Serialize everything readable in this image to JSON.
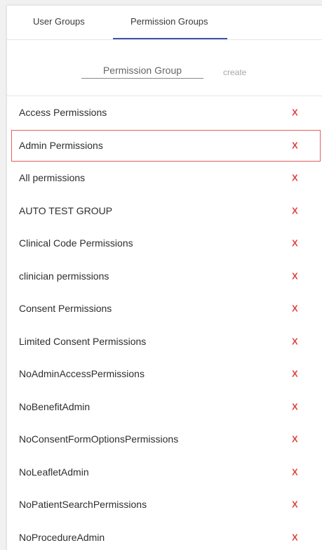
{
  "tabs": [
    {
      "label": "User Groups",
      "active": false
    },
    {
      "label": "Permission Groups",
      "active": true
    }
  ],
  "accent_color": "#3f51b5",
  "create": {
    "placeholder": "Permission Group",
    "value": "",
    "button_label": "create"
  },
  "delete_label": "X",
  "delete_color": "#e04545",
  "selected_index": 1,
  "groups": [
    {
      "label": "Access Permissions"
    },
    {
      "label": "Admin Permissions"
    },
    {
      "label": "All permissions"
    },
    {
      "label": "AUTO TEST GROUP"
    },
    {
      "label": "Clinical Code Permissions"
    },
    {
      "label": "clinician permissions"
    },
    {
      "label": "Consent Permissions"
    },
    {
      "label": "Limited Consent Permissions"
    },
    {
      "label": "NoAdminAccessPermissions"
    },
    {
      "label": "NoBenefitAdmin"
    },
    {
      "label": "NoConsentFormOptionsPermissions"
    },
    {
      "label": "NoLeafletAdmin"
    },
    {
      "label": "NoPatientSearchPermissions"
    },
    {
      "label": "NoProcedureAdmin"
    }
  ]
}
